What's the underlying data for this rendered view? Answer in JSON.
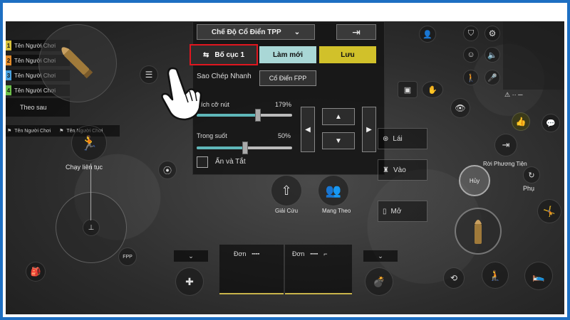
{
  "player_list": {
    "players": [
      {
        "num": "1",
        "name": "Tên Người Chơi",
        "color": "#d7c13a"
      },
      {
        "num": "2",
        "name": "Tên Người Chơi",
        "color": "#e08a2a"
      },
      {
        "num": "3",
        "name": "Tên Người Chơi",
        "color": "#4aa2e0"
      },
      {
        "num": "4",
        "name": "Tên Người Chơi",
        "color": "#6cc04a"
      }
    ],
    "follow_label": "Theo sau",
    "team_bar": [
      "Tên Người Chơi",
      "Tên Người Chơi"
    ]
  },
  "left_controls": {
    "sprint_label": "Chạy liên tục",
    "fpp_label": "FPP"
  },
  "panel": {
    "mode_select": "Chế Độ Cổ Điển TPP",
    "layout_button": "Bố cục 1",
    "new_button": "Làm mới",
    "save_button": "Lưu",
    "quick_copy_label": "Sao Chép Nhanh",
    "classic_fpp_button": "Cổ Điển FPP",
    "button_size": {
      "label": "Kích cỡ nút",
      "value": "179%",
      "fraction": 0.6
    },
    "opacity": {
      "label": "Trong suốt",
      "value": "50%",
      "fraction": 0.5
    },
    "hide_all_label": "Ẩn và Tắt"
  },
  "center_actions": {
    "rescue_label": "Giải Cứu",
    "carry_label": "Mang Theo"
  },
  "right_controls": {
    "drive_label": "Lái",
    "enter_label": "Vào",
    "open_label": "Mở",
    "exit_vehicle_label": "Rời Phương Tiện",
    "passenger_label": "Phụ",
    "cancel_label": "Hủy"
  },
  "bottom_slots": {
    "slot1_label": "Đơn",
    "slot2_label": "Đơn"
  },
  "colors": {
    "highlight_red": "#e0161f",
    "new_button_bg": "#a9d7d6",
    "save_button_bg": "#d1c12a",
    "frame_blue": "#1e6fc2"
  }
}
